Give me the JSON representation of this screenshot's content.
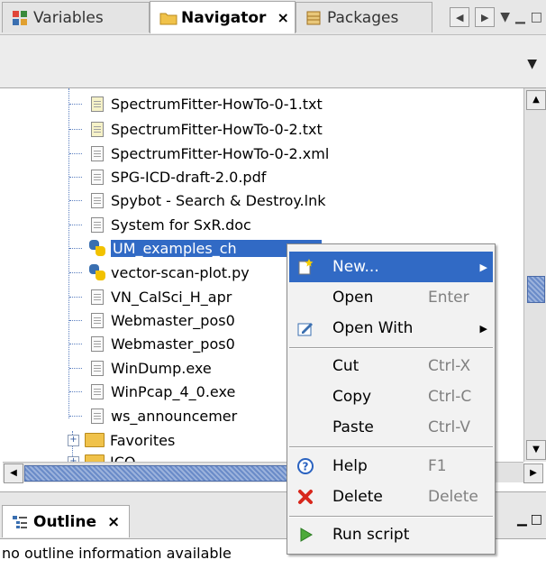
{
  "tabs": [
    {
      "label": "Variables",
      "active": false
    },
    {
      "label": "Navigator",
      "active": true,
      "close": "×"
    },
    {
      "label": "Packages",
      "active": false
    }
  ],
  "tree": {
    "files": [
      {
        "name": "SpectrumFitter-HowTo-0-1.txt",
        "icon": "text-file-icon"
      },
      {
        "name": "SpectrumFitter-HowTo-0-2.txt",
        "icon": "text-file-icon"
      },
      {
        "name": "SpectrumFitter-HowTo-0-2.xml",
        "icon": "file-icon"
      },
      {
        "name": "SPG-ICD-draft-2.0.pdf",
        "icon": "file-icon"
      },
      {
        "name": "Spybot - Search & Destroy.lnk",
        "icon": "file-icon"
      },
      {
        "name": "System for SxR.doc",
        "icon": "file-icon"
      },
      {
        "name": "UM_examples_ch",
        "icon": "python-icon",
        "selected": true
      },
      {
        "name": "vector-scan-plot.py",
        "icon": "python-icon"
      },
      {
        "name": "VN_CalSci_H_apr",
        "icon": "file-icon"
      },
      {
        "name": "Webmaster_pos0",
        "icon": "file-icon"
      },
      {
        "name": "Webmaster_pos0",
        "icon": "file-icon"
      },
      {
        "name": "WinDump.exe",
        "icon": "file-icon"
      },
      {
        "name": "WinPcap_4_0.exe",
        "icon": "file-icon"
      },
      {
        "name": "ws_announcemer",
        "icon": "file-icon"
      }
    ],
    "folders": [
      {
        "name": "Favorites"
      },
      {
        "name": "ICO"
      }
    ]
  },
  "outline": {
    "tab_label": "Outline",
    "close": "×",
    "message": "no outline information available"
  },
  "context_menu": {
    "items": [
      {
        "label": "New...",
        "shortcut": "",
        "submenu": true,
        "icon": "new-icon",
        "highlighted": true
      },
      {
        "label": "Open",
        "shortcut": "Enter"
      },
      {
        "label": "Open With",
        "shortcut": "",
        "submenu": true,
        "icon": "open-with-icon"
      },
      {
        "label": "Cut",
        "shortcut": "Ctrl-X"
      },
      {
        "label": "Copy",
        "shortcut": "Ctrl-C"
      },
      {
        "label": "Paste",
        "shortcut": "Ctrl-V"
      },
      {
        "label": "Help",
        "shortcut": "F1",
        "icon": "help-icon"
      },
      {
        "label": "Delete",
        "shortcut": "Delete",
        "icon": "delete-icon"
      },
      {
        "label": "Run script",
        "shortcut": "",
        "icon": "run-icon"
      }
    ]
  },
  "colors": {
    "selection": "#316ac5",
    "tree_lines": "#5b7fc0"
  }
}
